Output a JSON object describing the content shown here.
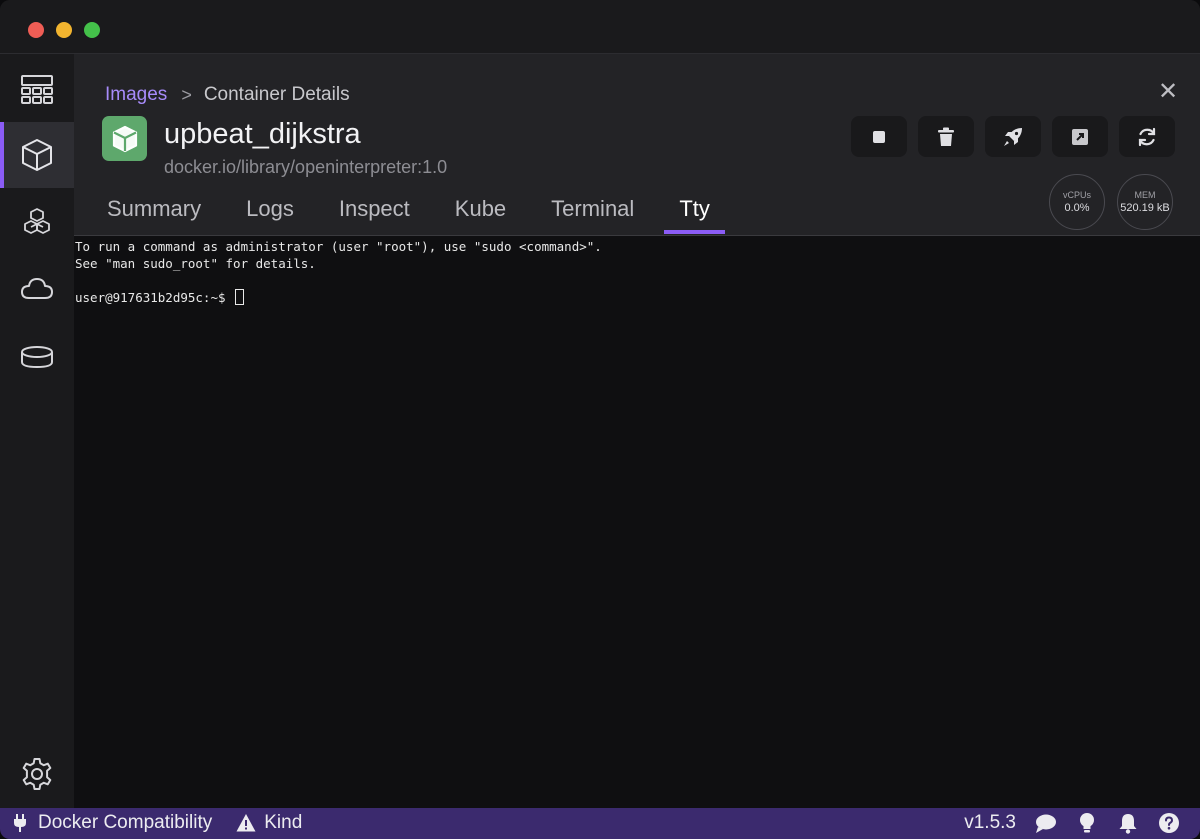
{
  "window": {
    "traffic_lights": [
      "close",
      "minimize",
      "zoom"
    ]
  },
  "sidebar": {
    "items": [
      {
        "name": "dashboard",
        "icon": "dashboard-icon",
        "active": false
      },
      {
        "name": "containers",
        "icon": "container-icon",
        "active": true
      },
      {
        "name": "pods",
        "icon": "pods-icon",
        "active": false
      },
      {
        "name": "images",
        "icon": "cloud-icon",
        "active": false
      },
      {
        "name": "volumes",
        "icon": "volume-icon",
        "active": false
      }
    ],
    "settings_icon": "gear-icon"
  },
  "breadcrumb": {
    "parent": "Images",
    "separator": ">",
    "current": "Container Details"
  },
  "container": {
    "name": "upbeat_dijkstra",
    "image": "docker.io/library/openinterpreter:1.0",
    "icon_color": "#5ea86c"
  },
  "actions": [
    {
      "name": "stop",
      "icon": "stop-icon"
    },
    {
      "name": "delete",
      "icon": "trash-icon"
    },
    {
      "name": "deploy",
      "icon": "rocket-icon"
    },
    {
      "name": "open-external",
      "icon": "external-link-icon"
    },
    {
      "name": "restart",
      "icon": "refresh-icon"
    }
  ],
  "stats": {
    "cpu_label": "vCPUs",
    "cpu_value": "0.0%",
    "mem_label": "MEM",
    "mem_value": "520.19 kB"
  },
  "tabs": [
    {
      "label": "Summary",
      "active": false
    },
    {
      "label": "Logs",
      "active": false
    },
    {
      "label": "Inspect",
      "active": false
    },
    {
      "label": "Kube",
      "active": false
    },
    {
      "label": "Terminal",
      "active": false
    },
    {
      "label": "Tty",
      "active": true
    }
  ],
  "terminal": {
    "lines": [
      "To run a command as administrator (user \"root\"), use \"sudo <command>\".",
      "See \"man sudo_root\" for details.",
      ""
    ],
    "prompt": "user@917631b2d95c:~$ "
  },
  "statusbar": {
    "left": [
      {
        "label": "Docker Compatibility",
        "icon": "plug-icon"
      },
      {
        "label": "Kind",
        "icon": "warning-icon"
      }
    ],
    "version": "v1.5.3",
    "right_icons": [
      "chat-icon",
      "lightbulb-icon",
      "bell-icon",
      "help-icon"
    ]
  },
  "colors": {
    "accent": "#8b5cf6",
    "statusbar": "#3b2a6e",
    "container_icon": "#5ea86c"
  }
}
